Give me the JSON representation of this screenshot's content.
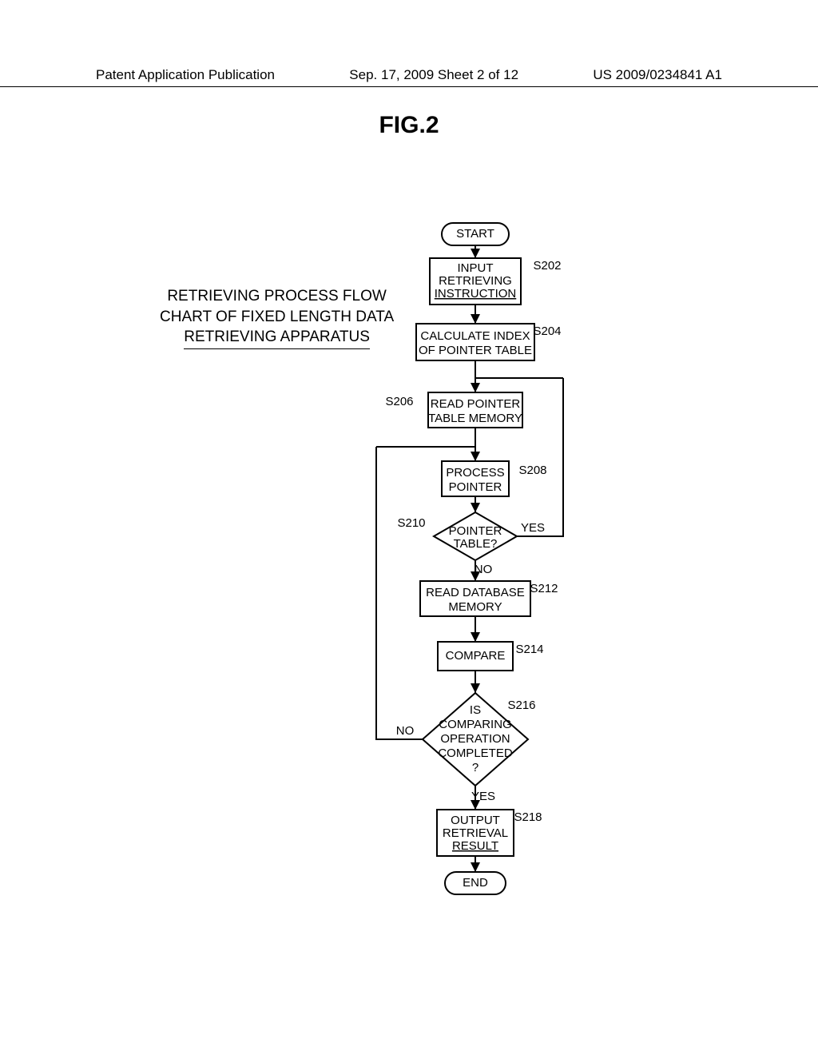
{
  "header": {
    "left": "Patent Application Publication",
    "center": "Sep. 17, 2009  Sheet 2 of 12",
    "right": "US 2009/0234841 A1"
  },
  "figure_label": "FIG.2",
  "caption": {
    "line1": "RETRIEVING PROCESS FLOW",
    "line2": "CHART OF FIXED LENGTH DATA",
    "line3": "RETRIEVING APPARATUS"
  },
  "nodes": {
    "start": "START",
    "s202_a": "INPUT",
    "s202_b": "RETRIEVING",
    "s202_c": "INSTRUCTION",
    "s204_a": "CALCULATE INDEX",
    "s204_b": "OF POINTER TABLE",
    "s206_a": "READ POINTER",
    "s206_b": "TABLE MEMORY",
    "s208_a": "PROCESS",
    "s208_b": "POINTER",
    "s210_a": "POINTER",
    "s210_b": "TABLE?",
    "s212_a": "READ DATABASE",
    "s212_b": "MEMORY",
    "s214": "COMPARE",
    "s216_a": "IS",
    "s216_b": "COMPARING",
    "s216_c": "OPERATION",
    "s216_d": "COMPLETED",
    "s216_e": "?",
    "s218_a": "OUTPUT",
    "s218_b": "RETRIEVAL",
    "s218_c": "RESULT",
    "end": "END"
  },
  "labels": {
    "s202": "S202",
    "s204": "S204",
    "s206": "S206",
    "s208": "S208",
    "s210": "S210",
    "s212": "S212",
    "s214": "S214",
    "s216": "S216",
    "s218": "S218",
    "yes": "YES",
    "no": "NO"
  },
  "chart_data": {
    "type": "diagram",
    "title": "Retrieving process flow chart of fixed length data retrieving apparatus",
    "steps": [
      {
        "id": "start",
        "shape": "terminator",
        "text": "START"
      },
      {
        "id": "S202",
        "shape": "process",
        "text": "INPUT RETRIEVING INSTRUCTION"
      },
      {
        "id": "S204",
        "shape": "process",
        "text": "CALCULATE INDEX OF POINTER TABLE"
      },
      {
        "id": "S206",
        "shape": "process",
        "text": "READ POINTER TABLE MEMORY"
      },
      {
        "id": "S208",
        "shape": "process",
        "text": "PROCESS POINTER"
      },
      {
        "id": "S210",
        "shape": "decision",
        "text": "POINTER TABLE?"
      },
      {
        "id": "S212",
        "shape": "process",
        "text": "READ DATABASE MEMORY"
      },
      {
        "id": "S214",
        "shape": "process",
        "text": "COMPARE"
      },
      {
        "id": "S216",
        "shape": "decision",
        "text": "IS COMPARING OPERATION COMPLETED?"
      },
      {
        "id": "S218",
        "shape": "process",
        "text": "OUTPUT RETRIEVAL RESULT"
      },
      {
        "id": "end",
        "shape": "terminator",
        "text": "END"
      }
    ],
    "edges": [
      {
        "from": "start",
        "to": "S202"
      },
      {
        "from": "S202",
        "to": "S204"
      },
      {
        "from": "S204",
        "to": "S206"
      },
      {
        "from": "S206",
        "to": "S208"
      },
      {
        "from": "S208",
        "to": "S210"
      },
      {
        "from": "S210",
        "to": "S206",
        "label": "YES"
      },
      {
        "from": "S210",
        "to": "S212",
        "label": "NO"
      },
      {
        "from": "S212",
        "to": "S214"
      },
      {
        "from": "S214",
        "to": "S216"
      },
      {
        "from": "S216",
        "to": "S208",
        "label": "NO"
      },
      {
        "from": "S216",
        "to": "S218",
        "label": "YES"
      },
      {
        "from": "S218",
        "to": "end"
      }
    ]
  }
}
